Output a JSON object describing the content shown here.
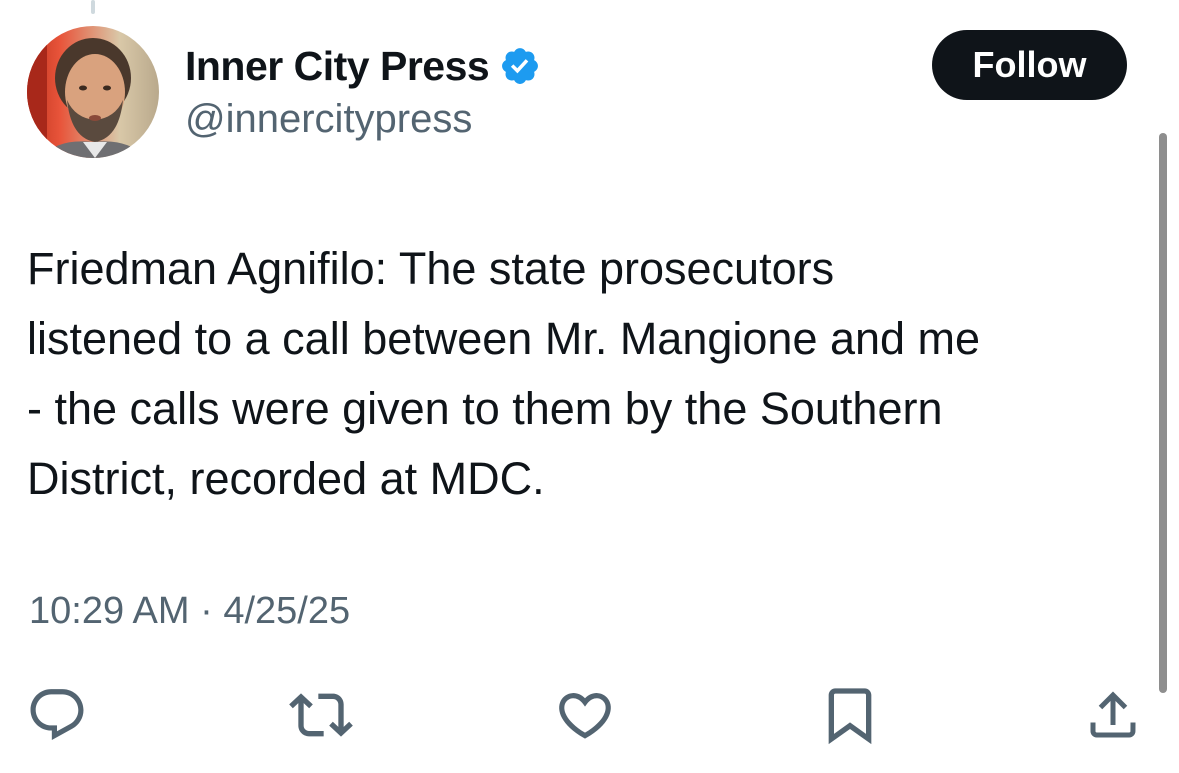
{
  "author": {
    "display_name": "Inner City Press",
    "handle": "@innercitypress",
    "verified": true,
    "avatar_icon": "profile-photo"
  },
  "follow_button": {
    "label": "Follow"
  },
  "tweet": {
    "lines": [
      "Friedman Agnifilo: The state prosecutors",
      "listened to a call between Mr. Mangione and me",
      "- the calls were given to them by the Southern",
      "District, recorded at MDC."
    ],
    "time": "10:29 AM",
    "separator": "·",
    "date": "4/25/25"
  },
  "actions": [
    {
      "icon": "reply-icon"
    },
    {
      "icon": "retweet-icon"
    },
    {
      "icon": "like-icon"
    },
    {
      "icon": "bookmark-icon"
    },
    {
      "icon": "share-icon"
    }
  ],
  "colors": {
    "text_primary": "#0f1419",
    "text_secondary": "#536471",
    "verified_blue": "#1d9bf0",
    "button_bg": "#0f1419"
  }
}
